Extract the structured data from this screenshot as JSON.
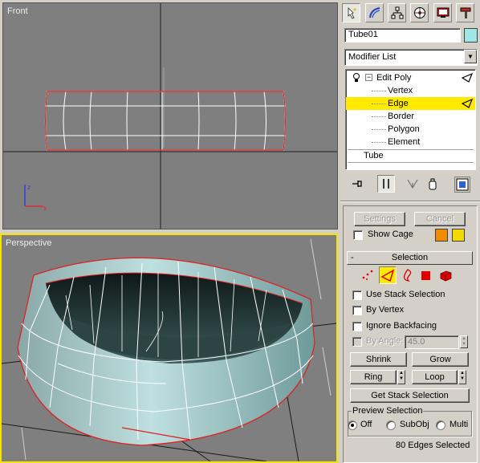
{
  "viewports": {
    "front_label": "Front",
    "perspective_label": "Perspective"
  },
  "panel": {
    "tabs": [
      "create-icon",
      "modify-icon",
      "hierarchy-icon",
      "motion-icon",
      "display-icon",
      "utilities-icon"
    ],
    "object_name": "Tube01",
    "object_color": "#9fe6e6",
    "modifier_list": "Modifier List",
    "stack": {
      "edit_poly": "Edit Poly",
      "sub_levels": [
        "Vertex",
        "Edge",
        "Border",
        "Polygon",
        "Element"
      ],
      "selected_sub_level": "Edge",
      "base_object": "Tube"
    },
    "settings_label": "Settings",
    "cancel_label": "Cancel",
    "show_cage_label": "Show Cage",
    "cage_colors": [
      "#f08c00",
      "#f5d800"
    ],
    "selection": {
      "rollout_label": "Selection",
      "rollout_toggle": "-",
      "use_stack_selection": "Use Stack Selection",
      "by_vertex": "By Vertex",
      "ignore_backfacing": "Ignore Backfacing",
      "by_angle_label": "By Angle:",
      "by_angle_value": "45.0",
      "shrink_label": "Shrink",
      "grow_label": "Grow",
      "ring_label": "Ring",
      "loop_label": "Loop",
      "get_stack_selection": "Get Stack Selection",
      "preview_selection": "Preview Selection",
      "preview_off": "Off",
      "preview_subobj": "SubObj",
      "preview_multi": "Multi",
      "status": "80 Edges Selected"
    }
  }
}
